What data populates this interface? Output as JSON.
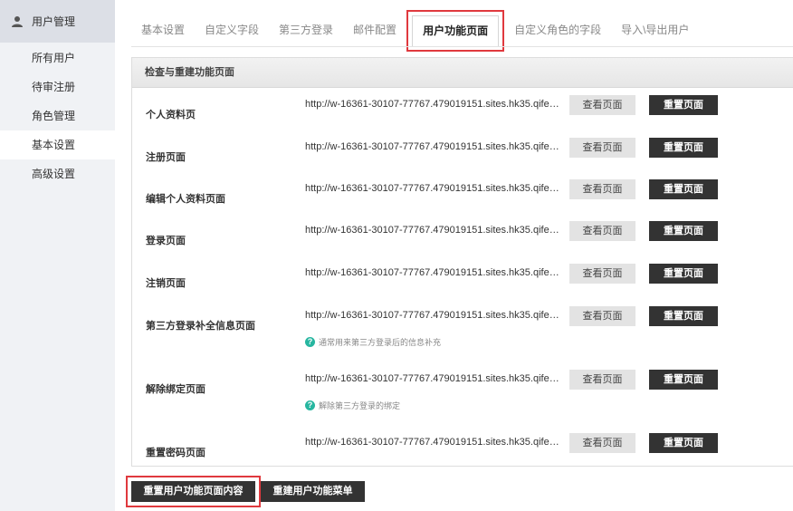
{
  "sidebar": {
    "section": "用户管理",
    "items": [
      {
        "label": "所有用户"
      },
      {
        "label": "待审注册"
      },
      {
        "label": "角色管理"
      },
      {
        "label": "基本设置"
      },
      {
        "label": "高级设置"
      }
    ],
    "active_index": 3
  },
  "tabs": [
    {
      "label": "基本设置"
    },
    {
      "label": "自定义字段"
    },
    {
      "label": "第三方登录"
    },
    {
      "label": "邮件配置"
    },
    {
      "label": "用户功能页面"
    },
    {
      "label": "自定义角色的字段"
    },
    {
      "label": "导入\\导出用户"
    }
  ],
  "active_tab": 4,
  "panel": {
    "title": "检查与重建功能页面",
    "view_label": "查看页面",
    "reset_label": "重置页面",
    "rows": [
      {
        "label": "个人资料页",
        "url": "http://w-16361-30107-77767.479019151.sites.hk35.qifeiye.com/",
        "hint": ""
      },
      {
        "label": "注册页面",
        "url": "http://w-16361-30107-77767.479019151.sites.hk35.qifeiye.com/",
        "hint": ""
      },
      {
        "label": "编辑个人资料页面",
        "url": "http://w-16361-30107-77767.479019151.sites.hk35.qifeiye.com/",
        "hint": ""
      },
      {
        "label": "登录页面",
        "url": "http://w-16361-30107-77767.479019151.sites.hk35.qifeiye.com/",
        "hint": ""
      },
      {
        "label": "注销页面",
        "url": "http://w-16361-30107-77767.479019151.sites.hk35.qifeiye.com/",
        "hint": ""
      },
      {
        "label": "第三方登录补全信息页面",
        "url": "http://w-16361-30107-77767.479019151.sites.hk35.qifeiye.com/",
        "hint": "通常用来第三方登录后的信息补充"
      },
      {
        "label": "解除绑定页面",
        "url": "http://w-16361-30107-77767.479019151.sites.hk35.qifeiye.com/",
        "hint": "解除第三方登录的绑定"
      },
      {
        "label": "重置密码页面",
        "url": "http://w-16361-30107-77767.479019151.sites.hk35.qifeiye.com/",
        "hint": ""
      }
    ]
  },
  "footer": {
    "reset_content_label": "重置用户功能页面内容",
    "rebuild_menu_label": "重建用户功能菜单"
  },
  "colors": {
    "highlight": "#e0393e",
    "dark_button": "#333333",
    "hint_icon": "#27b6a0"
  }
}
